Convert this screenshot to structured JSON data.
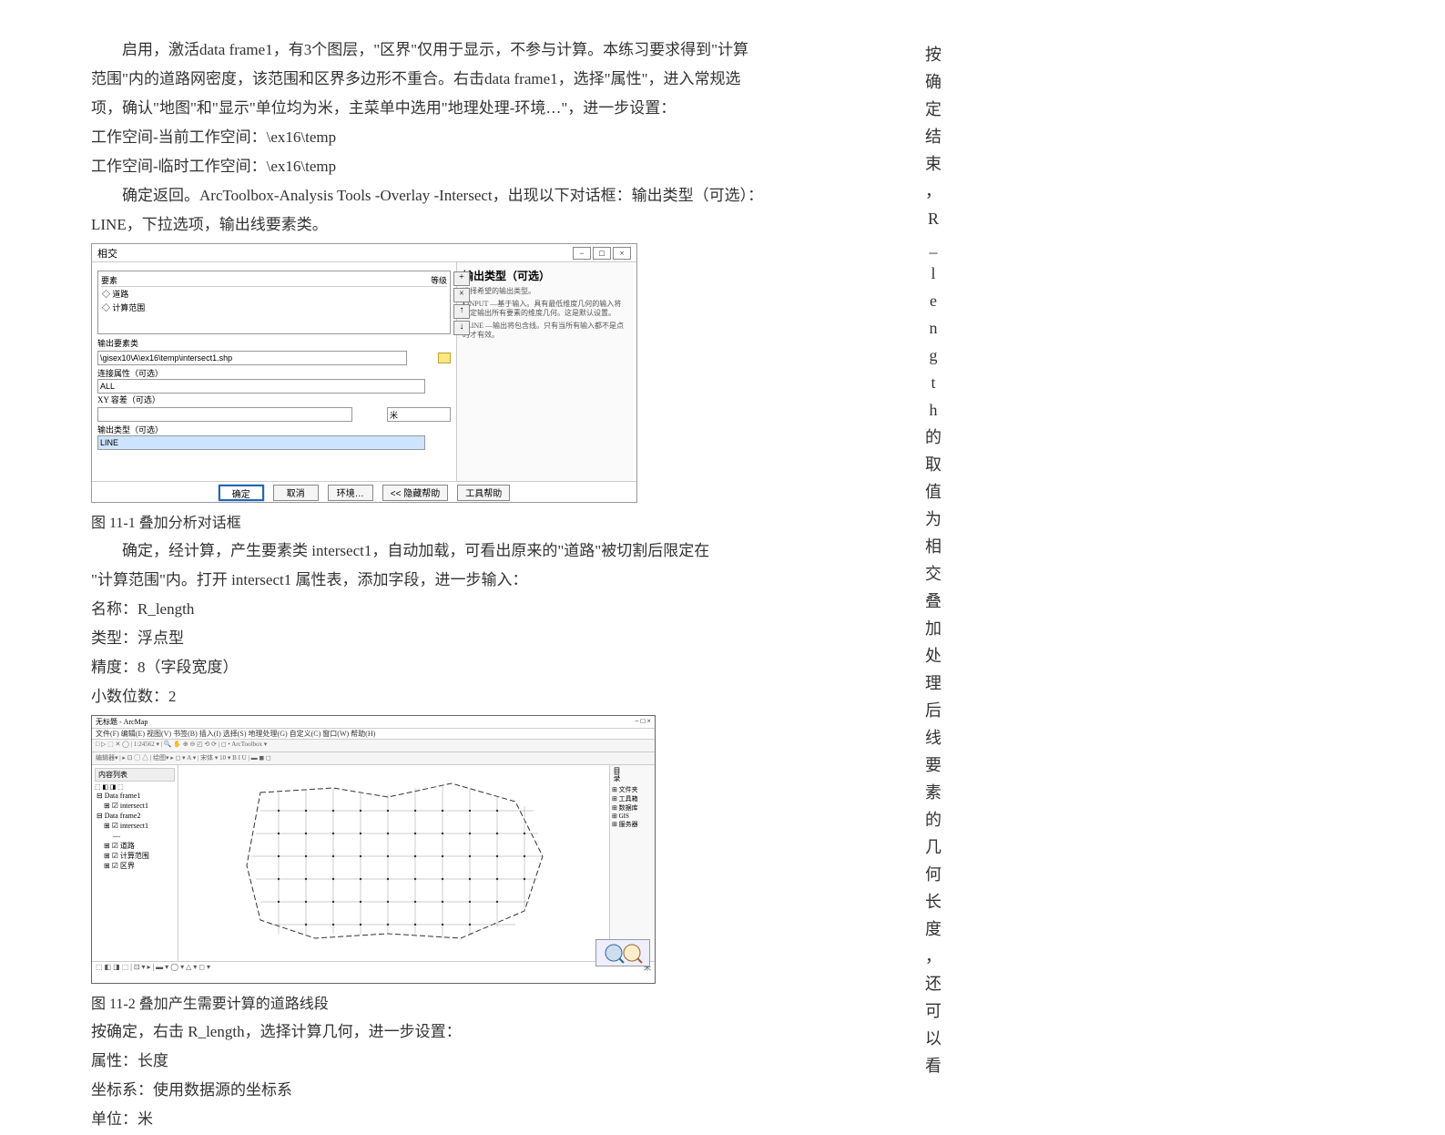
{
  "main": {
    "p1": "启用，激活data frame1，有3个图层，\"区界\"仅用于显示，不参与计算。本练习要求得到\"计算",
    "p2": "范围\"内的道路网密度，该范围和区界多边形不重合。右击data frame1，选择\"属性\"，进入常规选",
    "p3": "项，确认\"地图\"和\"显示\"单位均为米，主菜单中选用\"地理处理-环境…\"，进一步设置：",
    "p4": "工作空间-当前工作空间：\\ex16\\temp",
    "p5": "工作空间-临时工作空间：\\ex16\\temp",
    "p6": "确定返回。ArcToolbox-Analysis Tools -Overlay -Intersect，出现以下对话框：输出类型（可选）：",
    "p7": "LINE，下拉选项，输出线要素类。",
    "caption1": "图 11-1 叠加分析对话框",
    "p8": "确定，经计算，产生要素类 intersect1，自动加载，可看出原来的\"道路\"被切割后限定在",
    "p9": "\"计算范围\"内。打开 intersect1 属性表，添加字段，进一步输入：",
    "p10": "名称：R_length",
    "p11": "类型：浮点型",
    "p12": "精度：8（字段宽度）",
    "p13": "小数位数：2",
    "caption2": "图 11-2 叠加产生需要计算的道路线段",
    "p14": "按确定，右击 R_length，选择计算几何，进一步设置：",
    "p15": "属性：长度",
    "p16": "坐标系：使用数据源的坐标系",
    "p17": "单位：米"
  },
  "dialog": {
    "title": "相交",
    "list_header_feature": "要素",
    "list_header_rank": "等级",
    "item1": "道路",
    "item2": "计算范围",
    "output_label": "输出要素类",
    "output_value": "\\gisex10\\A\\ex16\\temp\\intersect1.shp",
    "join_label": "连接属性（可选）",
    "join_value": "ALL",
    "xy_label": "XY 容差（可选）",
    "output_type_label": "输出类型（可选）",
    "output_type_value": "LINE",
    "help_title": "输出类型（可选）",
    "help_text": "选择希望的输出类型。",
    "help_b1": "INPUT —基于输入。具有最低维度几何的输入将指定输出所有要素的维度几何。这是默认设置。",
    "help_b2": "LINE —输出将包含线。只有当所有输入都不是点时才有效。",
    "btn_ok": "确定",
    "btn_cancel": "取消",
    "btn_env": "环境…",
    "btn_hide_help": "<< 隐藏帮助",
    "btn_tool_help": "工具帮助"
  },
  "arcmap": {
    "title": "无标题 - ArcMap",
    "menu": "文件(F)  编辑(E)  视图(V)  书签(B)  插入(I)  选择(S)  地理处理(G)  自定义(C)  窗口(W)  帮助(H)",
    "toc_title": "内容列表",
    "df1": "Data frame1",
    "layer1": "intersect1",
    "df2": "Data frame2",
    "layer2a": "intersect1",
    "layer2b": "道路",
    "layer2c": "计算范围",
    "layer2d": "区界",
    "catalog": "目录",
    "status_right": "米"
  },
  "right_text": [
    "按",
    "确",
    "定",
    "结",
    "束",
    "，",
    "R",
    "_",
    "l",
    "e",
    "n",
    "g",
    "t",
    "h",
    "的",
    "取",
    "值",
    "为",
    "相",
    "交",
    "叠",
    "加",
    "处",
    "理",
    "后",
    "线",
    "要",
    "素",
    "的",
    "几",
    "何",
    "长",
    "度",
    "，",
    "还",
    "可",
    "以",
    "看"
  ]
}
